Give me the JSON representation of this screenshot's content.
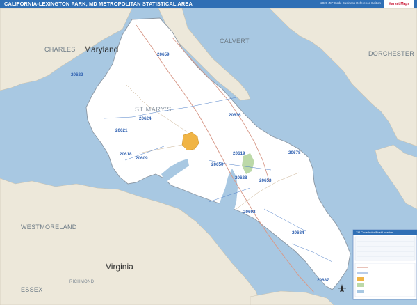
{
  "header": {
    "title": "CALIFORNIA-LEXINGTON PARK, MD METROPOLITAN STATISTICAL AREA",
    "edition": "2020 ZIP Code Business Reference Edition",
    "logo_text": "Market Maps"
  },
  "map": {
    "colors": {
      "water": "#a8c8e2",
      "land_outside": "#ede8da",
      "land_msa": "#ffffff",
      "highlight_city": "#f0b445",
      "park_green": "#bcd9a8",
      "zip_label": "#2d5fb0",
      "header_bar": "#2f6fb5"
    },
    "regions": {
      "charles": "CHARLES",
      "maryland": "Maryland",
      "calvert": "CALVERT",
      "dorchester": "DORCHESTER",
      "st_marys": "ST MARY'S",
      "westmoreland": "WESTMORELAND",
      "virginia": "Virginia",
      "richmond": "RICHMOND",
      "essex": "ESSEX"
    },
    "zips": {
      "z20659": "20659",
      "z20622": "20622",
      "z20636": "20636",
      "z20621": "20621",
      "z20624": "20624",
      "z20618": "20618",
      "z20609": "20609",
      "z20619": "20619",
      "z20650": "20650",
      "z20678": "20678",
      "z20628": "20628",
      "z20653": "20653",
      "z20692": "20692",
      "z20684": "20684",
      "z20687": "20687"
    },
    "legend": {
      "title": "ZIP Code Index/Post Location"
    }
  }
}
